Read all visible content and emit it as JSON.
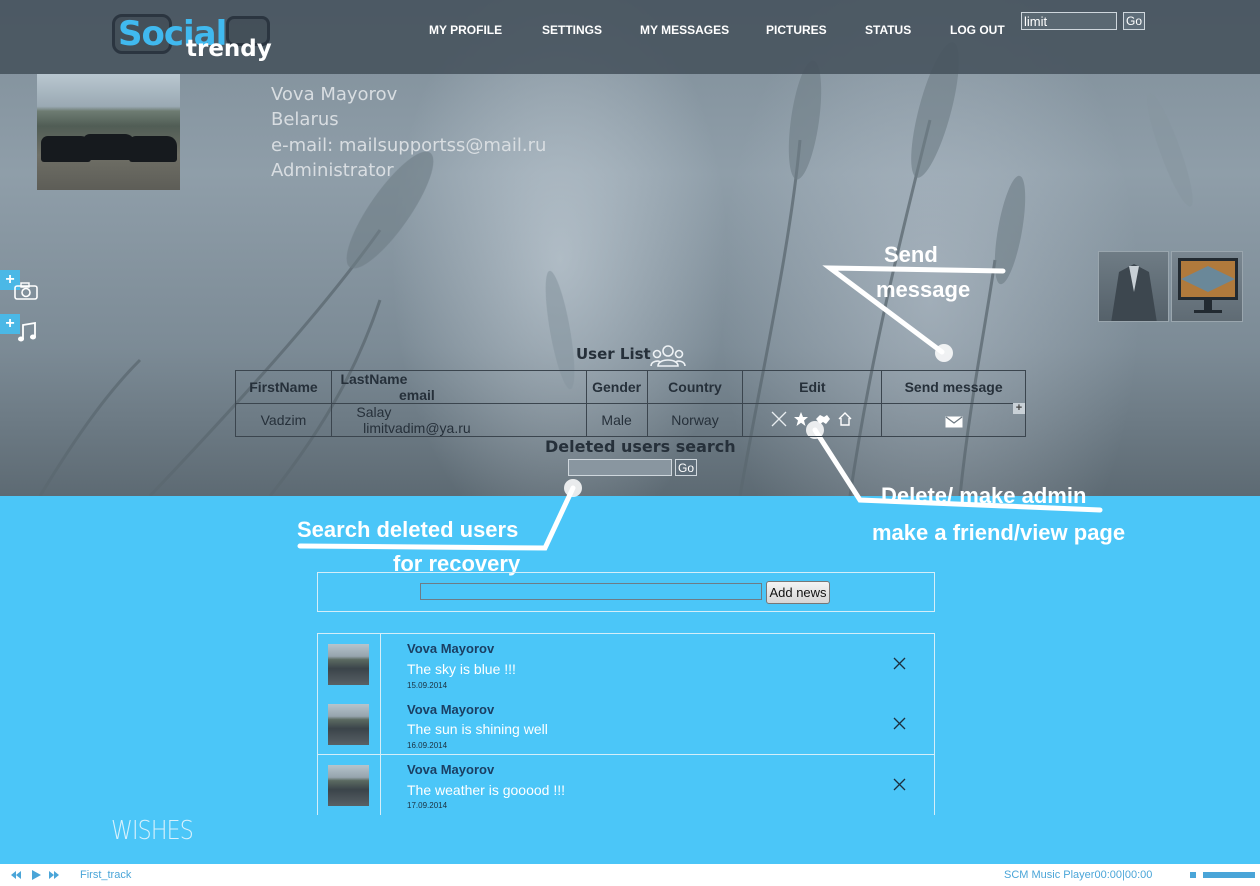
{
  "header": {
    "logo": {
      "word1": "Social",
      "word2": "trendy"
    },
    "nav": [
      {
        "label": "MY PROFILE"
      },
      {
        "label": "SETTINGS"
      },
      {
        "label": "MY MESSAGES"
      },
      {
        "label": "PICTURES"
      },
      {
        "label": "STATUS"
      },
      {
        "label": "LOG OUT"
      }
    ],
    "search": {
      "value": "limit",
      "go_label": "Go"
    }
  },
  "profile": {
    "name": "Vova Mayorov",
    "country": "Belarus",
    "email": "e-mail: mailsupportss@mail.ru",
    "role": "Administrator"
  },
  "side": {
    "add_symbol": "+",
    "camera_icon": "camera-icon",
    "music_icon": "music-note-icon"
  },
  "annotations": {
    "send_message_1": "Send",
    "send_message_2": "message",
    "delete_admin_1": "Delete/ make admin",
    "delete_admin_2": "make a friend/view page",
    "search_deleted_1": "Search deleted users",
    "search_deleted_2": "for recovery"
  },
  "user_list": {
    "title": "User List",
    "columns": [
      "FirstName",
      "LastName",
      "email",
      "Gender",
      "Country",
      "Edit",
      "Send message"
    ],
    "rows": [
      {
        "first": "Vadzim",
        "last": "Salay",
        "email": "limitvadim@ya.ru",
        "gender": "Male",
        "country": "Norway"
      }
    ],
    "edit_icons": [
      "delete-icon",
      "star-icon",
      "handshake-icon",
      "home-icon"
    ],
    "send_icon": "envelope-icon",
    "plus_symbol": "+"
  },
  "deleted_search": {
    "title": "Deleted users search",
    "value": "",
    "go_label": "Go"
  },
  "news": {
    "add_input_value": "",
    "add_button": "Add news",
    "items": [
      {
        "author": "Vova Mayorov",
        "text": "The sky is blue !!!",
        "date": "15.09.2014"
      },
      {
        "author": "Vova Mayorov",
        "text": "The sun is shining well",
        "date": "16.09.2014"
      },
      {
        "author": "Vova Mayorov",
        "text": "The weather is gooood !!!",
        "date": "17.09.2014"
      }
    ]
  },
  "wishes": "WISHES",
  "player": {
    "track": "First_track",
    "name": "SCM Music Player",
    "time": "00:00|00:00"
  },
  "colors": {
    "accent": "#4bc6f8",
    "topbar": "#46525c",
    "logo_blue": "#40b9ef"
  }
}
